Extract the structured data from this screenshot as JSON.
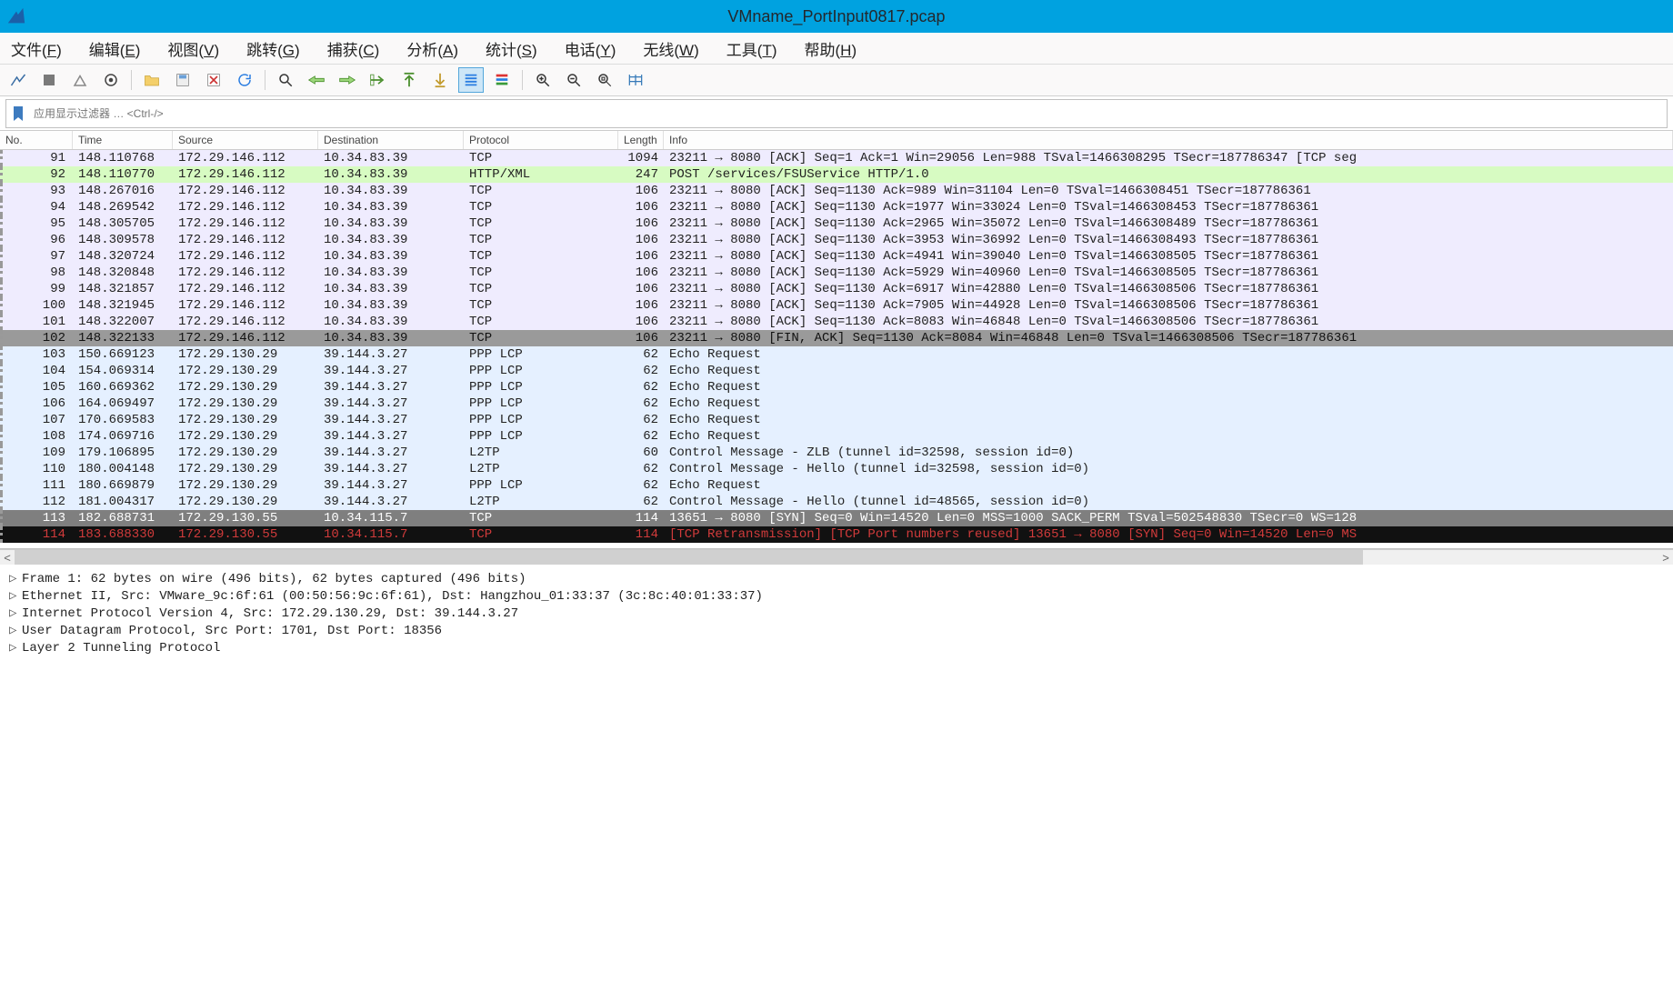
{
  "window": {
    "title": "VMname_PortInput0817.pcap"
  },
  "menu": {
    "file": {
      "label": "文件",
      "key": "F"
    },
    "edit": {
      "label": "编辑",
      "key": "E"
    },
    "view": {
      "label": "视图",
      "key": "V"
    },
    "go": {
      "label": "跳转",
      "key": "G"
    },
    "capture": {
      "label": "捕获",
      "key": "C"
    },
    "analyze": {
      "label": "分析",
      "key": "A"
    },
    "stats": {
      "label": "统计",
      "key": "S"
    },
    "teleph": {
      "label": "电话",
      "key": "Y"
    },
    "wireless": {
      "label": "无线",
      "key": "W"
    },
    "tools": {
      "label": "工具",
      "key": "T"
    },
    "help": {
      "label": "帮助",
      "key": "H"
    }
  },
  "filter": {
    "placeholder": "应用显示过滤器 … <Ctrl-/>"
  },
  "columns": {
    "no": "No.",
    "time": "Time",
    "src": "Source",
    "dst": "Destination",
    "proto": "Protocol",
    "len": "Length",
    "info": "Info"
  },
  "rows": [
    {
      "cls": "lav",
      "no": 91,
      "time": "148.110768",
      "src": "172.29.146.112",
      "dst": "10.34.83.39",
      "proto": "TCP",
      "len": 1094,
      "info": "23211 → 8080 [ACK] Seq=1 Ack=1 Win=29056 Len=988 TSval=1466308295 TSecr=187786347 [TCP seg"
    },
    {
      "cls": "green",
      "no": 92,
      "time": "148.110770",
      "src": "172.29.146.112",
      "dst": "10.34.83.39",
      "proto": "HTTP/XML",
      "len": 247,
      "info": "POST /services/FSUService HTTP/1.0"
    },
    {
      "cls": "lav",
      "no": 93,
      "time": "148.267016",
      "src": "172.29.146.112",
      "dst": "10.34.83.39",
      "proto": "TCP",
      "len": 106,
      "info": "23211 → 8080 [ACK] Seq=1130 Ack=989 Win=31104 Len=0 TSval=1466308451 TSecr=187786361"
    },
    {
      "cls": "lav",
      "no": 94,
      "time": "148.269542",
      "src": "172.29.146.112",
      "dst": "10.34.83.39",
      "proto": "TCP",
      "len": 106,
      "info": "23211 → 8080 [ACK] Seq=1130 Ack=1977 Win=33024 Len=0 TSval=1466308453 TSecr=187786361"
    },
    {
      "cls": "lav",
      "no": 95,
      "time": "148.305705",
      "src": "172.29.146.112",
      "dst": "10.34.83.39",
      "proto": "TCP",
      "len": 106,
      "info": "23211 → 8080 [ACK] Seq=1130 Ack=2965 Win=35072 Len=0 TSval=1466308489 TSecr=187786361"
    },
    {
      "cls": "lav",
      "no": 96,
      "time": "148.309578",
      "src": "172.29.146.112",
      "dst": "10.34.83.39",
      "proto": "TCP",
      "len": 106,
      "info": "23211 → 8080 [ACK] Seq=1130 Ack=3953 Win=36992 Len=0 TSval=1466308493 TSecr=187786361"
    },
    {
      "cls": "lav",
      "no": 97,
      "time": "148.320724",
      "src": "172.29.146.112",
      "dst": "10.34.83.39",
      "proto": "TCP",
      "len": 106,
      "info": "23211 → 8080 [ACK] Seq=1130 Ack=4941 Win=39040 Len=0 TSval=1466308505 TSecr=187786361"
    },
    {
      "cls": "lav",
      "no": 98,
      "time": "148.320848",
      "src": "172.29.146.112",
      "dst": "10.34.83.39",
      "proto": "TCP",
      "len": 106,
      "info": "23211 → 8080 [ACK] Seq=1130 Ack=5929 Win=40960 Len=0 TSval=1466308505 TSecr=187786361"
    },
    {
      "cls": "lav",
      "no": 99,
      "time": "148.321857",
      "src": "172.29.146.112",
      "dst": "10.34.83.39",
      "proto": "TCP",
      "len": 106,
      "info": "23211 → 8080 [ACK] Seq=1130 Ack=6917 Win=42880 Len=0 TSval=1466308506 TSecr=187786361"
    },
    {
      "cls": "lav",
      "no": 100,
      "time": "148.321945",
      "src": "172.29.146.112",
      "dst": "10.34.83.39",
      "proto": "TCP",
      "len": 106,
      "info": "23211 → 8080 [ACK] Seq=1130 Ack=7905 Win=44928 Len=0 TSval=1466308506 TSecr=187786361"
    },
    {
      "cls": "lav",
      "no": 101,
      "time": "148.322007",
      "src": "172.29.146.112",
      "dst": "10.34.83.39",
      "proto": "TCP",
      "len": 106,
      "info": "23211 → 8080 [ACK] Seq=1130 Ack=8083 Win=46848 Len=0 TSval=1466308506 TSecr=187786361"
    },
    {
      "cls": "gray1",
      "no": 102,
      "time": "148.322133",
      "src": "172.29.146.112",
      "dst": "10.34.83.39",
      "proto": "TCP",
      "len": 106,
      "info": "23211 → 8080 [FIN, ACK] Seq=1130 Ack=8084 Win=46848 Len=0 TSval=1466308506 TSecr=187786361"
    },
    {
      "cls": "blue",
      "no": 103,
      "time": "150.669123",
      "src": "172.29.130.29",
      "dst": "39.144.3.27",
      "proto": "PPP LCP",
      "len": 62,
      "info": "Echo Request"
    },
    {
      "cls": "blue",
      "no": 104,
      "time": "154.069314",
      "src": "172.29.130.29",
      "dst": "39.144.3.27",
      "proto": "PPP LCP",
      "len": 62,
      "info": "Echo Request"
    },
    {
      "cls": "blue",
      "no": 105,
      "time": "160.669362",
      "src": "172.29.130.29",
      "dst": "39.144.3.27",
      "proto": "PPP LCP",
      "len": 62,
      "info": "Echo Request"
    },
    {
      "cls": "blue",
      "no": 106,
      "time": "164.069497",
      "src": "172.29.130.29",
      "dst": "39.144.3.27",
      "proto": "PPP LCP",
      "len": 62,
      "info": "Echo Request"
    },
    {
      "cls": "blue",
      "no": 107,
      "time": "170.669583",
      "src": "172.29.130.29",
      "dst": "39.144.3.27",
      "proto": "PPP LCP",
      "len": 62,
      "info": "Echo Request"
    },
    {
      "cls": "blue",
      "no": 108,
      "time": "174.069716",
      "src": "172.29.130.29",
      "dst": "39.144.3.27",
      "proto": "PPP LCP",
      "len": 62,
      "info": "Echo Request"
    },
    {
      "cls": "blue",
      "no": 109,
      "time": "179.106895",
      "src": "172.29.130.29",
      "dst": "39.144.3.27",
      "proto": "L2TP",
      "len": 60,
      "info": "Control Message - ZLB    (tunnel id=32598, session id=0)"
    },
    {
      "cls": "blue",
      "no": 110,
      "time": "180.004148",
      "src": "172.29.130.29",
      "dst": "39.144.3.27",
      "proto": "L2TP",
      "len": 62,
      "info": "Control Message - Hello (tunnel id=32598, session id=0)"
    },
    {
      "cls": "blue",
      "no": 111,
      "time": "180.669879",
      "src": "172.29.130.29",
      "dst": "39.144.3.27",
      "proto": "PPP LCP",
      "len": 62,
      "info": "Echo Request"
    },
    {
      "cls": "blue",
      "no": 112,
      "time": "181.004317",
      "src": "172.29.130.29",
      "dst": "39.144.3.27",
      "proto": "L2TP",
      "len": 62,
      "info": "Control Message - Hello (tunnel id=48565, session id=0)"
    },
    {
      "cls": "gray2",
      "no": 113,
      "time": "182.688731",
      "src": "172.29.130.55",
      "dst": "10.34.115.7",
      "proto": "TCP",
      "len": 114,
      "info": "13651 → 8080 [SYN] Seq=0 Win=14520 Len=0 MSS=1000 SACK_PERM TSval=502548830 TSecr=0 WS=128"
    },
    {
      "cls": "black",
      "no": 114,
      "time": "183.688330",
      "src": "172.29.130.55",
      "dst": "10.34.115.7",
      "proto": "TCP",
      "len": 114,
      "info": "[TCP Retransmission] [TCP Port numbers reused] 13651 → 8080 [SYN] Seq=0 Win=14520 Len=0 MS"
    }
  ],
  "details": {
    "l0": "Frame 1: 62 bytes on wire (496 bits), 62 bytes captured (496 bits)",
    "l1": "Ethernet II, Src: VMware_9c:6f:61 (00:50:56:9c:6f:61), Dst: Hangzhou_01:33:37 (3c:8c:40:01:33:37)",
    "l2": "Internet Protocol Version 4, Src: 172.29.130.29, Dst: 39.144.3.27",
    "l3": "User Datagram Protocol, Src Port: 1701, Dst Port: 18356",
    "l4": "Layer 2 Tunneling Protocol"
  }
}
